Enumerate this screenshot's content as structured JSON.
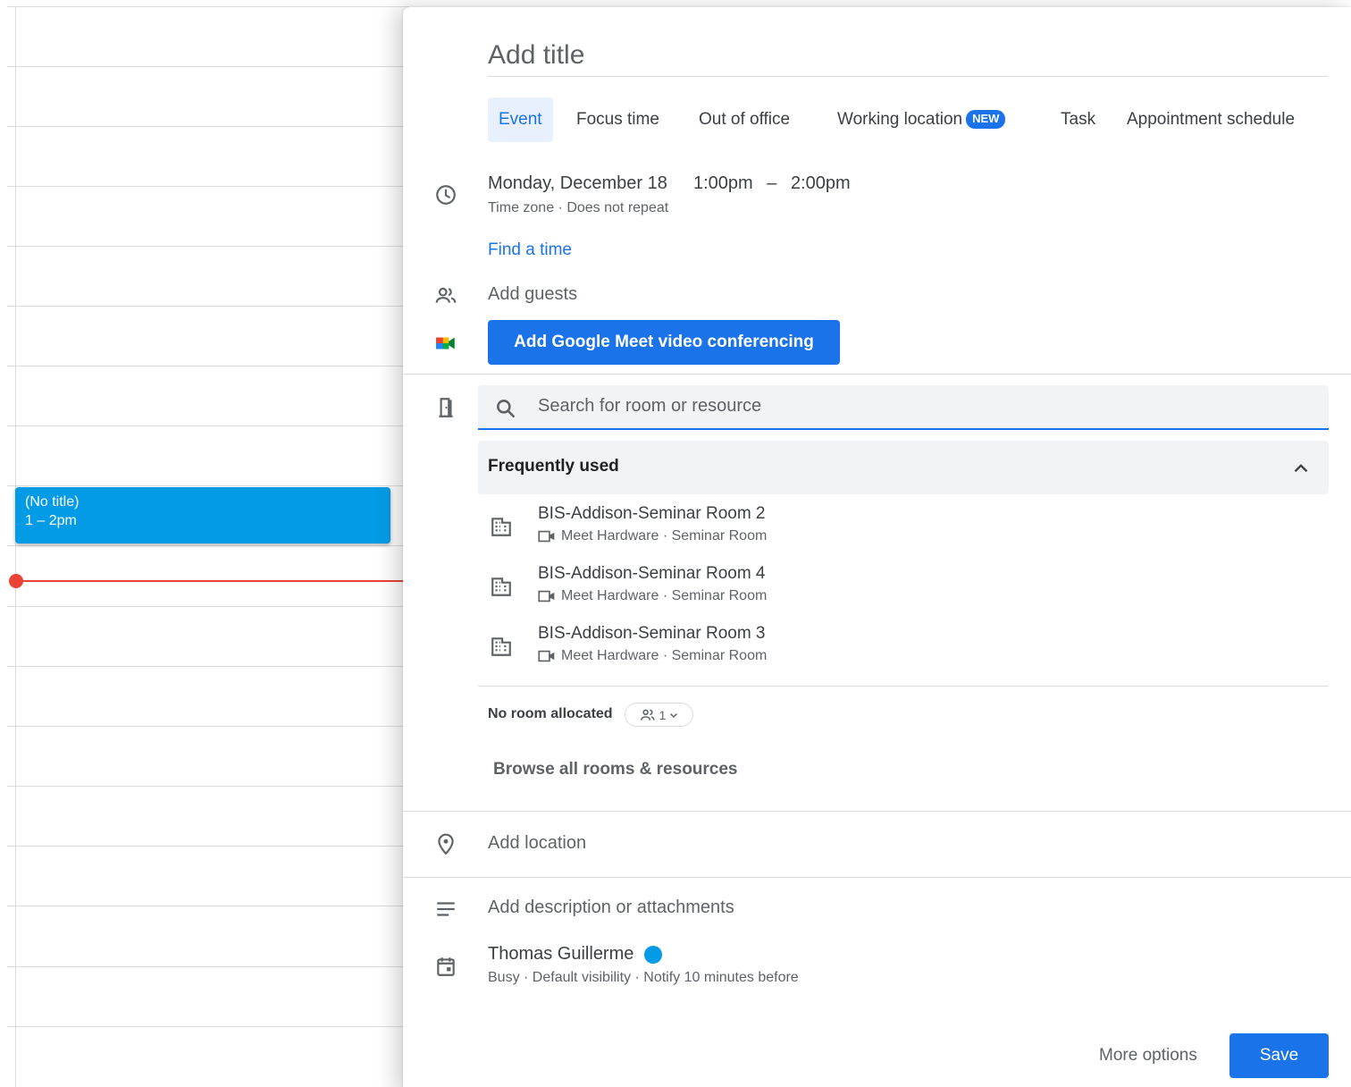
{
  "calendar": {
    "event": {
      "title": "(No title)",
      "time": "1 – 2pm"
    }
  },
  "dialog": {
    "title_placeholder": "Add title",
    "tabs": [
      {
        "label": "Event",
        "active": true
      },
      {
        "label": "Focus time"
      },
      {
        "label": "Out of office"
      },
      {
        "label": "Working location",
        "badge": "NEW"
      },
      {
        "label": "Task"
      },
      {
        "label": "Appointment schedule"
      }
    ],
    "date": "Monday, December 18",
    "start_time": "1:00pm",
    "time_separator": "–",
    "end_time": "2:00pm",
    "timezone": "Time zone",
    "repeat": "Does not repeat",
    "find_time": "Find a time",
    "guests_placeholder": "Add guests",
    "meet_button": "Add Google Meet video conferencing",
    "room_search_placeholder": "Search for room or resource",
    "frequently_used_label": "Frequently used",
    "rooms": [
      {
        "name": "BIS-Addison-Seminar Room 2",
        "hardware": "Meet Hardware",
        "type": "Seminar Room"
      },
      {
        "name": "BIS-Addison-Seminar Room 4",
        "hardware": "Meet Hardware",
        "type": "Seminar Room"
      },
      {
        "name": "BIS-Addison-Seminar Room 3",
        "hardware": "Meet Hardware",
        "type": "Seminar Room"
      }
    ],
    "no_room": "No room allocated",
    "attendee_count": "1",
    "browse_rooms": "Browse all rooms & resources",
    "location_placeholder": "Add location",
    "description_placeholder": "Add description or attachments",
    "calendar_owner": "Thomas Guillerme",
    "status": "Busy",
    "visibility": "Default visibility",
    "notification": "Notify 10 minutes before",
    "more_options": "More options",
    "save": "Save",
    "colors": {
      "accent": "#1a73e8",
      "event": "#039be5",
      "now": "#ea4335"
    }
  }
}
